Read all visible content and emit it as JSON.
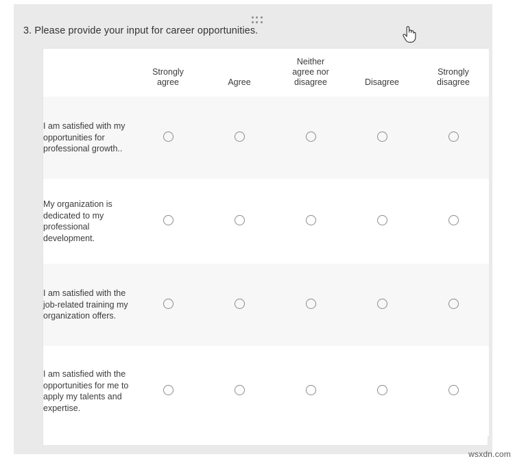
{
  "page": {
    "watermark": "wsxdn.com",
    "background_color": "#ffffff",
    "card_color": "#eaeaea",
    "table_color": "#ffffff",
    "row_alt_color": "#f7f7f7",
    "text_color": "#3b3b3b"
  },
  "question": {
    "number": "3.",
    "title": "3. Please provide your input for career opportunities.",
    "drag_handle_icon": "grip-dots-icon",
    "cursor_icon": "pointing-hand-cursor"
  },
  "matrix": {
    "statement_header": "",
    "columns": [
      {
        "label": "Strongly\nagree",
        "line1": "Strongly",
        "line2": "agree"
      },
      {
        "label": "Agree",
        "line1": "Agree",
        "line2": ""
      },
      {
        "label": "Neither agree nor disagree",
        "line1": "Neither",
        "line2": "agree nor",
        "line3": "disagree"
      },
      {
        "label": "Disagree",
        "line1": "Disagree",
        "line2": ""
      },
      {
        "label": "Strongly disagree",
        "line1": "Strongly",
        "line2": "disagree"
      }
    ],
    "rows": [
      {
        "statement": "I am satisfied with my opportunities for professional growth..",
        "selected": null
      },
      {
        "statement": "My organization is dedicated to my professional development.",
        "selected": null
      },
      {
        "statement": "I am satisfied with the job-related training my organization offers.",
        "selected": null
      },
      {
        "statement": "I am satisfied with the opportunities for me to apply my talents and expertise.",
        "selected": null
      }
    ]
  }
}
